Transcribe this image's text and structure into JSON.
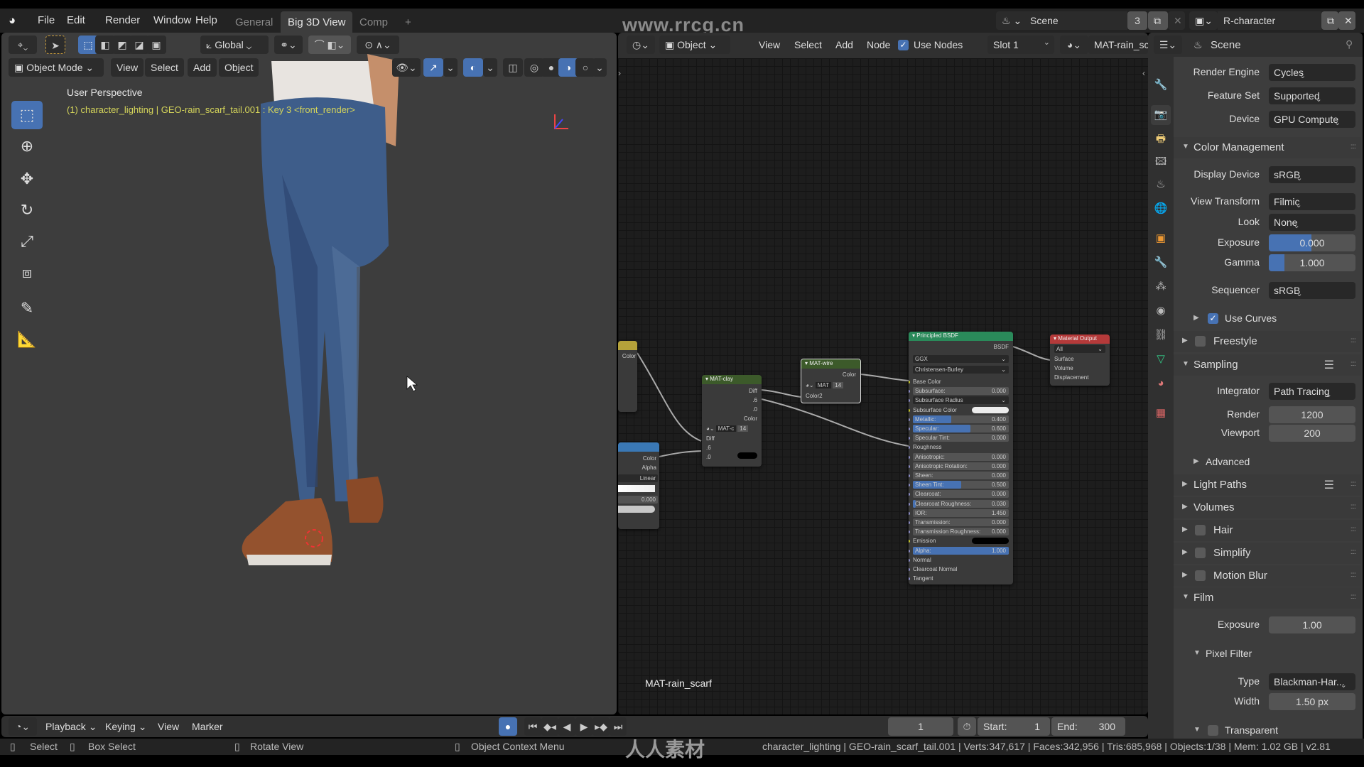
{
  "topbar": {
    "menu": [
      "File",
      "Edit",
      "Render",
      "Window",
      "Help"
    ],
    "workspaces": [
      {
        "label": "General",
        "active": false
      },
      {
        "label": "Big 3D View",
        "active": true
      },
      {
        "label": "Comp",
        "active": false
      }
    ],
    "add_workspace": "+",
    "watermark": "www.rrcg.cn",
    "scene": {
      "name": "Scene",
      "users": "3"
    },
    "view_layer": "R-character"
  },
  "viewport": {
    "transform_orientation": "Global",
    "mode": "Object Mode",
    "menus": [
      "View",
      "Select",
      "Add",
      "Object"
    ],
    "view_name": "User Perspective",
    "object_info": "(1) character_lighting | GEO-rain_scarf_tail.001 : Key 3 <front_render>",
    "tools": [
      "select-box-icon",
      "cursor-icon",
      "move-icon",
      "rotate-icon",
      "scale-icon",
      "transform-icon",
      "annotate-icon",
      "measure-icon"
    ]
  },
  "node_editor": {
    "object_type": "Object",
    "menus": [
      "View",
      "Select",
      "Add",
      "Node"
    ],
    "use_nodes": {
      "label": "Use Nodes",
      "checked": true
    },
    "slot": "Slot 1",
    "material": "MAT-rain_sc",
    "material_label": "MAT-rain_scarf",
    "nodes": {
      "yellow_partial": {
        "output": "Color"
      },
      "blue_partial": {
        "outputs": [
          "Color",
          "Alpha"
        ],
        "interpolation": "Linear",
        "value": "0.000"
      },
      "mat_clay": {
        "title": "MAT-clay",
        "outputs": [
          "Diff",
          ".6",
          ".0",
          "Color"
        ],
        "group": "MAT-c",
        "users": "14",
        "inputs": [
          "Diff",
          ".6",
          ".0"
        ]
      },
      "mat_wire": {
        "title": "MAT-wire",
        "output": "Color",
        "group": "MAT",
        "users": "14",
        "input": "Color2"
      },
      "principled": {
        "title": "Principled BSDF",
        "output": "BSDF",
        "distribution": "GGX",
        "subsurface_method": "Christensen-Burley",
        "rows": [
          {
            "label": "Base Color",
            "kind": "socket"
          },
          {
            "label": "Subsurface:",
            "value": "0.000",
            "kind": "field",
            "fill": 0
          },
          {
            "label": "Subsurface Radius",
            "kind": "dropdown"
          },
          {
            "label": "Subsurface Color",
            "kind": "color",
            "color": "#ececec"
          },
          {
            "label": "Metallic:",
            "value": "0.400",
            "kind": "field",
            "fill": 0.4
          },
          {
            "label": "Specular:",
            "value": "0.600",
            "kind": "field",
            "fill": 0.6
          },
          {
            "label": "Specular Tint:",
            "value": "0.000",
            "kind": "field",
            "fill": 0
          },
          {
            "label": "Roughness",
            "kind": "socket"
          },
          {
            "label": "Anisotropic:",
            "value": "0.000",
            "kind": "field",
            "fill": 0
          },
          {
            "label": "Anisotropic Rotation:",
            "value": "0.000",
            "kind": "field",
            "fill": 0
          },
          {
            "label": "Sheen:",
            "value": "0.000",
            "kind": "field",
            "fill": 0
          },
          {
            "label": "Sheen Tint:",
            "value": "0.500",
            "kind": "field",
            "fill": 0.5
          },
          {
            "label": "Clearcoat:",
            "value": "0.000",
            "kind": "field",
            "fill": 0
          },
          {
            "label": "Clearcoat Roughness:",
            "value": "0.030",
            "kind": "field",
            "fill": 0.03
          },
          {
            "label": "IOR:",
            "value": "1.450",
            "kind": "field",
            "fill": 0
          },
          {
            "label": "Transmission:",
            "value": "0.000",
            "kind": "field",
            "fill": 0
          },
          {
            "label": "Transmission Roughness:",
            "value": "0.000",
            "kind": "field",
            "fill": 0
          },
          {
            "label": "Emission",
            "kind": "color",
            "color": "#000000"
          },
          {
            "label": "Alpha:",
            "value": "1.000",
            "kind": "field",
            "fill": 1
          },
          {
            "label": "Normal",
            "kind": "socket"
          },
          {
            "label": "Clearcoat Normal",
            "kind": "socket"
          },
          {
            "label": "Tangent",
            "kind": "socket"
          }
        ]
      },
      "material_output": {
        "title": "Material Output",
        "target": "All",
        "inputs": [
          "Surface",
          "Volume",
          "Displacement"
        ]
      }
    }
  },
  "properties": {
    "header": "Scene",
    "tabs": [
      "tool-icon",
      "render-icon",
      "output-icon",
      "view-layer-icon",
      "scene-icon",
      "world-icon",
      "object-icon",
      "modifier-icon",
      "particles-icon",
      "physics-icon",
      "constraints-icon",
      "data-icon",
      "material-icon",
      "texture-icon"
    ],
    "rows": [
      {
        "type": "dropdown",
        "label": "Render Engine",
        "value": "Cycles"
      },
      {
        "type": "dropdown",
        "label": "Feature Set",
        "value": "Supported"
      },
      {
        "type": "dropdown",
        "label": "Device",
        "value": "GPU Compute"
      },
      {
        "type": "panel",
        "label": "Color Management",
        "open": true
      },
      {
        "type": "dropdown",
        "label": "Display Device",
        "value": "sRGB"
      },
      {
        "type": "dropdown",
        "label": "View Transform",
        "value": "Filmic"
      },
      {
        "type": "dropdown",
        "label": "Look",
        "value": "None"
      },
      {
        "type": "slider",
        "label": "Exposure",
        "value": "0.000",
        "fill": 0.49
      },
      {
        "type": "slider",
        "label": "Gamma",
        "value": "1.000",
        "fill": 0.18
      },
      {
        "type": "dropdown",
        "label": "Sequencer",
        "value": "sRGB"
      },
      {
        "type": "subpanel",
        "label": "Use Curves",
        "open": false,
        "checkbox": true,
        "checked": true
      },
      {
        "type": "panel",
        "label": "Freestyle",
        "open": false,
        "checkbox": true,
        "checked": false
      },
      {
        "type": "panel",
        "label": "Sampling",
        "open": true,
        "presets": true
      },
      {
        "type": "dropdown",
        "label": "Integrator",
        "value": "Path Tracing"
      },
      {
        "type": "number",
        "label": "Render",
        "value": "1200"
      },
      {
        "type": "number",
        "label": "Viewport",
        "value": "200"
      },
      {
        "type": "subpanel",
        "label": "Advanced",
        "open": false
      },
      {
        "type": "panel",
        "label": "Light Paths",
        "open": false,
        "presets": true
      },
      {
        "type": "panel",
        "label": "Volumes",
        "open": false
      },
      {
        "type": "panel",
        "label": "Hair",
        "open": false,
        "checkbox": true,
        "checked": false
      },
      {
        "type": "panel",
        "label": "Simplify",
        "open": false,
        "checkbox": true,
        "checked": false
      },
      {
        "type": "panel",
        "label": "Motion Blur",
        "open": false,
        "checkbox": true,
        "checked": false
      },
      {
        "type": "panel",
        "label": "Film",
        "open": true
      },
      {
        "type": "number",
        "label": "Exposure",
        "value": "1.00"
      },
      {
        "type": "subpanel",
        "label": "Pixel Filter",
        "open": true
      },
      {
        "type": "dropdown",
        "label": "Type",
        "value": "Blackman-Har..."
      },
      {
        "type": "number",
        "label": "Width",
        "value": "1.50 px"
      },
      {
        "type": "subpanel",
        "label": "Transparent",
        "open": true,
        "checkbox": true,
        "checked": false
      }
    ]
  },
  "timeline": {
    "menus": [
      {
        "label": "Playback",
        "dropdown": true
      },
      {
        "label": "Keying",
        "dropdown": true
      },
      {
        "label": "View"
      },
      {
        "label": "Marker"
      }
    ],
    "current_frame": "1",
    "start_label": "Start:",
    "start": "1",
    "end_label": "End:",
    "end": "300"
  },
  "statusbar": {
    "hints": [
      "Select",
      "Box Select",
      "Rotate View",
      "Object Context Menu"
    ],
    "stats": "character_lighting | GEO-rain_scarf_tail.001 | Verts:347,617 | Faces:342,956 | Tris:685,968 | Objects:1/38 | Mem: 1.02 GB | v2.81",
    "watermark_logo": "人人素材"
  },
  "colors": {
    "accent": "#4772b3",
    "node_shader": "#2a8a5a",
    "node_group": "#3c5a2a",
    "node_output": "#b53a3a",
    "text_info": "#d4d45a"
  }
}
